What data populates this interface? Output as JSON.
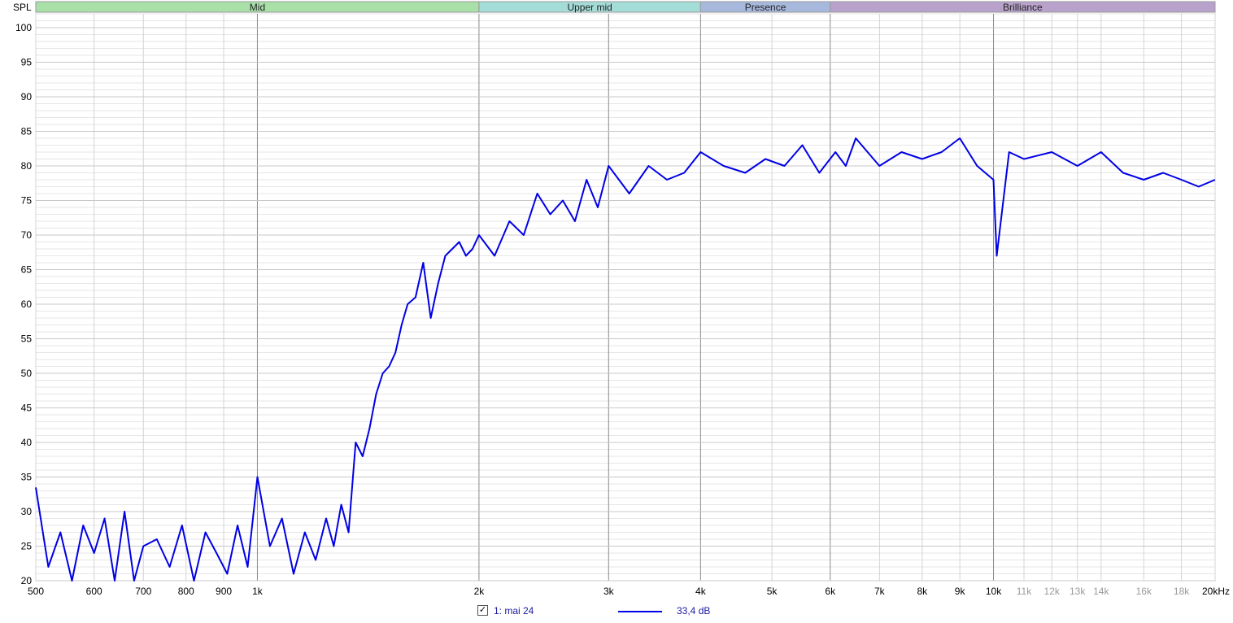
{
  "chart_data": {
    "type": "line",
    "ylabel": "SPL",
    "x_scale": "log",
    "xlim": [
      500,
      20000
    ],
    "ylim": [
      20,
      102
    ],
    "y_ticks": [
      20,
      25,
      30,
      35,
      40,
      45,
      50,
      55,
      60,
      65,
      70,
      75,
      80,
      85,
      90,
      95,
      100
    ],
    "x_ticks": [
      {
        "value": 500,
        "label": "500",
        "major": true
      },
      {
        "value": 600,
        "label": "600",
        "major": true
      },
      {
        "value": 700,
        "label": "700",
        "major": true
      },
      {
        "value": 800,
        "label": "800",
        "major": true
      },
      {
        "value": 900,
        "label": "900",
        "major": true
      },
      {
        "value": 1000,
        "label": "1k",
        "major": true
      },
      {
        "value": 2000,
        "label": "2k",
        "major": true
      },
      {
        "value": 3000,
        "label": "3k",
        "major": true
      },
      {
        "value": 4000,
        "label": "4k",
        "major": true
      },
      {
        "value": 5000,
        "label": "5k",
        "major": true
      },
      {
        "value": 6000,
        "label": "6k",
        "major": true
      },
      {
        "value": 7000,
        "label": "7k",
        "major": true
      },
      {
        "value": 8000,
        "label": "8k",
        "major": true
      },
      {
        "value": 9000,
        "label": "9k",
        "major": true
      },
      {
        "value": 10000,
        "label": "10k",
        "major": true
      },
      {
        "value": 11000,
        "label": "11k",
        "major": false
      },
      {
        "value": 12000,
        "label": "12k",
        "major": false
      },
      {
        "value": 13000,
        "label": "13k",
        "major": false
      },
      {
        "value": 14000,
        "label": "14k",
        "major": false
      },
      {
        "value": 16000,
        "label": "16k",
        "major": false
      },
      {
        "value": 18000,
        "label": "18k",
        "major": false
      },
      {
        "value": 20000,
        "label": "20kHz",
        "major": true
      }
    ],
    "bands": [
      {
        "label": "Mid",
        "from": 500,
        "to": 2000,
        "color": "#a8e0a8"
      },
      {
        "label": "Upper mid",
        "from": 2000,
        "to": 4000,
        "color": "#a4dcd8"
      },
      {
        "label": "Presence",
        "from": 4000,
        "to": 6000,
        "color": "#a6b8dc"
      },
      {
        "label": "Brilliance",
        "from": 6000,
        "to": 20000,
        "color": "#b8a2cc"
      }
    ],
    "series": [
      {
        "name": "1: mai 24",
        "color": "#0000e6",
        "x": [
          500,
          520,
          540,
          560,
          580,
          600,
          620,
          640,
          660,
          680,
          700,
          730,
          760,
          790,
          820,
          850,
          880,
          910,
          940,
          970,
          1000,
          1040,
          1080,
          1120,
          1160,
          1200,
          1240,
          1270,
          1300,
          1330,
          1360,
          1390,
          1420,
          1450,
          1480,
          1510,
          1540,
          1570,
          1600,
          1640,
          1680,
          1720,
          1760,
          1800,
          1840,
          1880,
          1920,
          1960,
          2000,
          2100,
          2200,
          2300,
          2400,
          2500,
          2600,
          2700,
          2800,
          2900,
          3000,
          3200,
          3400,
          3600,
          3800,
          4000,
          4300,
          4600,
          4900,
          5200,
          5500,
          5800,
          6100,
          6300,
          6500,
          7000,
          7500,
          8000,
          8500,
          9000,
          9500,
          10000,
          10100,
          10500,
          11000,
          12000,
          13000,
          14000,
          15000,
          16000,
          17000,
          18000,
          19000,
          20000
        ],
        "y": [
          33.5,
          22,
          27,
          20,
          28,
          24,
          29,
          20,
          30,
          20,
          25,
          26,
          22,
          28,
          20,
          27,
          24,
          21,
          28,
          22,
          35,
          25,
          29,
          21,
          27,
          23,
          29,
          25,
          31,
          27,
          40,
          38,
          42,
          47,
          50,
          51,
          53,
          57,
          60,
          61,
          66,
          58,
          63,
          67,
          68,
          69,
          67,
          68,
          70,
          67,
          72,
          70,
          76,
          73,
          75,
          72,
          78,
          74,
          80,
          76,
          80,
          78,
          79,
          82,
          80,
          79,
          81,
          80,
          83,
          79,
          82,
          80,
          84,
          80,
          82,
          81,
          82,
          84,
          80,
          78,
          67,
          82,
          81,
          82,
          80,
          82,
          79,
          78,
          79,
          78,
          77,
          78
        ]
      }
    ]
  },
  "legend": {
    "checked": true,
    "check_glyph": "✓",
    "label": "1: mai 24",
    "value": "33,4 dB",
    "line_color": "#0000e6"
  }
}
